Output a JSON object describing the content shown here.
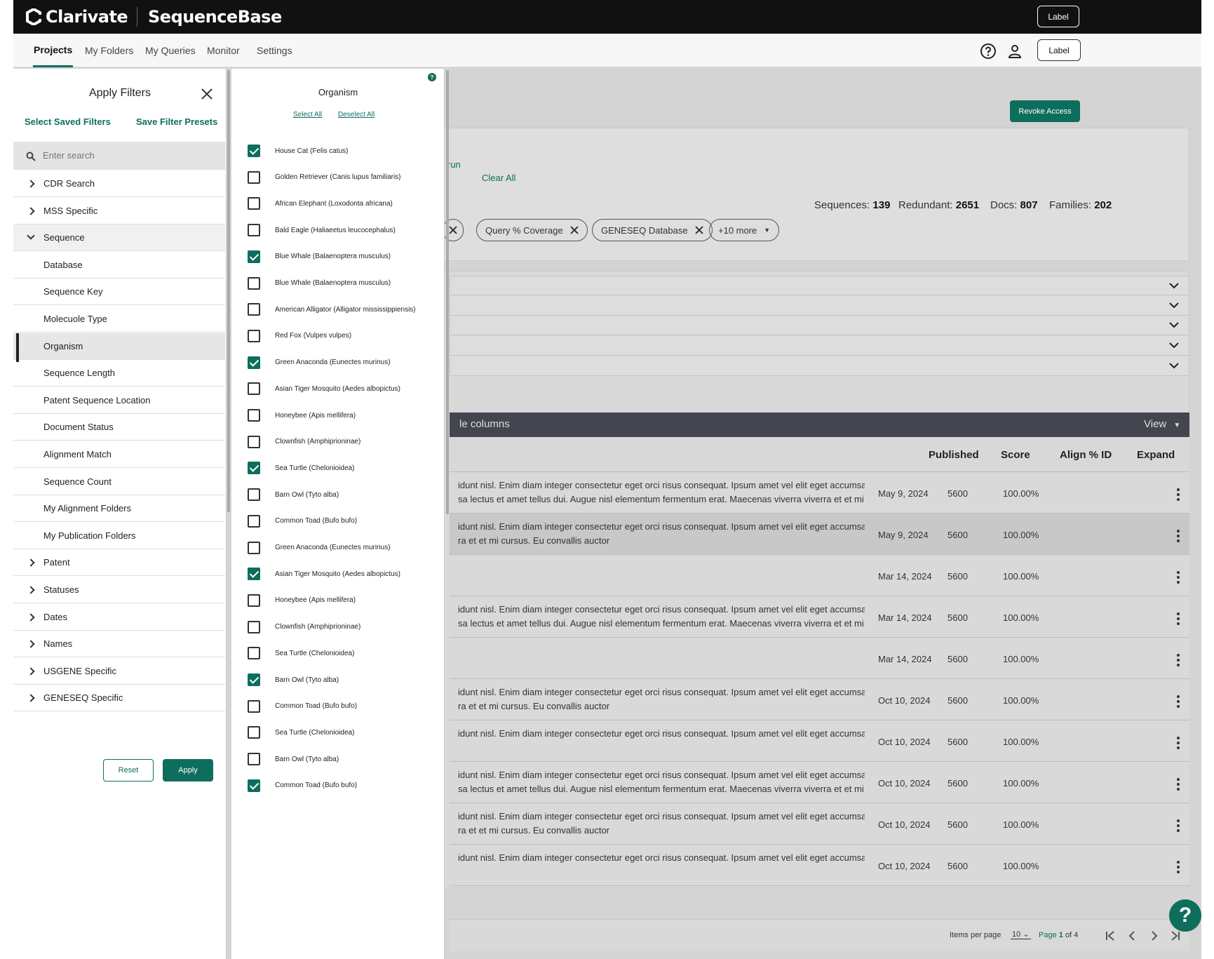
{
  "header": {
    "brand": "Clarivate",
    "product": "SequenceBase",
    "label_button": "Label"
  },
  "nav": {
    "tabs": [
      "Projects",
      "My Folders",
      "My Queries",
      "Monitor",
      "Settings"
    ],
    "active_tab": "Projects",
    "label_button": "Label",
    "icons": [
      "help-icon",
      "user-icon"
    ]
  },
  "main": {
    "revoke_button": "Revoke Access",
    "partial_link": "run",
    "clear_all": "Clear All",
    "stats": {
      "sequences_label": "Sequences:",
      "sequences": "139",
      "redundant_label": "Redundant:",
      "redundant": "2651",
      "docs_label": "Docs:",
      "docs": "807",
      "families_label": "Families:",
      "families": "202"
    },
    "chips": [
      "Query % Coverage",
      "GENESEQ Database"
    ],
    "more_chip": "+10 more",
    "table_bar_text": "le columns",
    "view_label": "View",
    "columns": [
      "Published",
      "Score",
      "Align % ID",
      "Expand"
    ],
    "rows": [
      {
        "line1": "idunt nisl. Enim diam integer consectetur eget orci risus consequat. Ipsum amet vel elit eget accumsan",
        "line2": "sa lectus et amet tellus dui. Augue nisl elementum fermentum erat. Maecenas viverra viverra et et mi",
        "published": "May 9, 2024",
        "score": "5600",
        "align": "100.00%"
      },
      {
        "line1": "idunt nisl. Enim diam integer consectetur eget orci risus consequat. Ipsum amet vel elit eget accumsan",
        "line2": "ra et et mi cursus. Eu convallis auctor",
        "published": "May 9, 2024",
        "score": "5600",
        "align": "100.00%"
      },
      {
        "line1": "",
        "line2": "",
        "published": "Mar 14, 2024",
        "score": "5600",
        "align": "100.00%"
      },
      {
        "line1": "idunt nisl. Enim diam integer consectetur eget orci risus consequat. Ipsum amet vel elit eget accumsan",
        "line2": "sa lectus et amet tellus dui. Augue nisl elementum fermentum erat. Maecenas viverra viverra et et mi",
        "published": "Mar 14, 2024",
        "score": "5600",
        "align": "100.00%"
      },
      {
        "line1": "",
        "line2": "",
        "published": "Mar 14, 2024",
        "score": "5600",
        "align": "100.00%"
      },
      {
        "line1": "idunt nisl. Enim diam integer consectetur eget orci risus consequat. Ipsum amet vel elit eget accumsan",
        "line2": "ra et et mi cursus. Eu convallis auctor",
        "published": "Oct 10, 2024",
        "score": "5600",
        "align": "100.00%"
      },
      {
        "line1": "idunt nisl. Enim diam integer consectetur eget orci risus consequat. Ipsum amet vel elit eget accumsan",
        "line2": "",
        "published": "Oct 10, 2024",
        "score": "5600",
        "align": "100.00%"
      },
      {
        "line1": "idunt nisl. Enim diam integer consectetur eget orci risus consequat. Ipsum amet vel elit eget accumsan",
        "line2": "sa lectus et amet tellus dui. Augue nisl elementum fermentum erat. Maecenas viverra viverra et et mi",
        "published": "Oct 10, 2024",
        "score": "5600",
        "align": "100.00%"
      },
      {
        "line1": "idunt nisl. Enim diam integer consectetur eget orci risus consequat. Ipsum amet vel elit eget accumsan",
        "line2": "ra et et mi cursus. Eu convallis auctor",
        "published": "Oct 10, 2024",
        "score": "5600",
        "align": "100.00%"
      },
      {
        "line1": "idunt nisl. Enim diam integer consectetur eget orci risus consequat. Ipsum amet vel elit eget accumsan",
        "line2": "",
        "published": "Oct 10, 2024",
        "score": "5600",
        "align": "100.00%"
      }
    ],
    "pager": {
      "items_per_page_label": "Items per page",
      "items_per_page": "10",
      "page_word": "Page",
      "current_page": "1",
      "of_text": "of 4"
    },
    "help_fab": "?"
  },
  "filters": {
    "title": "Apply Filters",
    "select_saved": "Select Saved Filters",
    "save_presets": "Save Filter Presets",
    "search_placeholder": "Enter search",
    "items": [
      {
        "label": "CDR Search",
        "kind": "group"
      },
      {
        "label": "MSS Specific",
        "kind": "group"
      },
      {
        "label": "Sequence",
        "kind": "open"
      },
      {
        "label": "Database",
        "kind": "child"
      },
      {
        "label": "Sequence Key",
        "kind": "child"
      },
      {
        "label": "Molecuole Type",
        "kind": "child"
      },
      {
        "label": "Organism",
        "kind": "selected"
      },
      {
        "label": "Sequence Length",
        "kind": "child"
      },
      {
        "label": "Patent Sequence Location",
        "kind": "child"
      },
      {
        "label": "Document Status",
        "kind": "child"
      },
      {
        "label": "Alignment Match",
        "kind": "child"
      },
      {
        "label": "Sequence Count",
        "kind": "child"
      },
      {
        "label": "My Alignment Folders",
        "kind": "child"
      },
      {
        "label": "My Publication Folders",
        "kind": "child"
      },
      {
        "label": "Patent",
        "kind": "group"
      },
      {
        "label": "Statuses",
        "kind": "group"
      },
      {
        "label": "Dates",
        "kind": "group"
      },
      {
        "label": "Names",
        "kind": "group"
      },
      {
        "label": "USGENE Specific",
        "kind": "group"
      },
      {
        "label": "GENESEQ Specific",
        "kind": "group"
      }
    ],
    "reset": "Reset",
    "apply": "Apply"
  },
  "organism": {
    "title": "Organism",
    "help": "?",
    "select_all": "Select All",
    "deselect_all": "Deselect All",
    "options": [
      {
        "label": "House Cat (Felis catus)",
        "checked": true
      },
      {
        "label": "Golden Retriever (Canis lupus familiaris)",
        "checked": false
      },
      {
        "label": "African Elephant (Loxodonta africana)",
        "checked": false
      },
      {
        "label": "Bald Eagle (Haliaeetus leucocephalus)",
        "checked": false
      },
      {
        "label": "Blue Whale (Balaenoptera musculus)",
        "checked": true
      },
      {
        "label": "Blue Whale (Balaenoptera musculus)",
        "checked": false
      },
      {
        "label": "American Alligator (Alligator mississippiensis)",
        "checked": false
      },
      {
        "label": "Red Fox (Vulpes vulpes)",
        "checked": false
      },
      {
        "label": "Green Anaconda (Eunectes murinus)",
        "checked": true
      },
      {
        "label": "Asian Tiger Mosquito (Aedes albopictus)",
        "checked": false
      },
      {
        "label": "Honeybee (Apis mellifera)",
        "checked": false
      },
      {
        "label": "Clownfish (Amphiprioninae)",
        "checked": false
      },
      {
        "label": "Sea Turtle (Chelonioidea)",
        "checked": true
      },
      {
        "label": "Barn Owl (Tyto alba)",
        "checked": false
      },
      {
        "label": "Common Toad (Bufo bufo)",
        "checked": false
      },
      {
        "label": "Green Anaconda (Eunectes murinus)",
        "checked": false
      },
      {
        "label": "Asian Tiger Mosquito (Aedes albopictus)",
        "checked": true
      },
      {
        "label": "Honeybee (Apis mellifera)",
        "checked": false
      },
      {
        "label": "Clownfish (Amphiprioninae)",
        "checked": false
      },
      {
        "label": "Sea Turtle (Chelonioidea)",
        "checked": false
      },
      {
        "label": "Barn Owl (Tyto alba)",
        "checked": true
      },
      {
        "label": "Common Toad (Bufo bufo)",
        "checked": false
      },
      {
        "label": "Sea Turtle (Chelonioidea)",
        "checked": false
      },
      {
        "label": "Barn Owl (Tyto alba)",
        "checked": false
      },
      {
        "label": "Common Toad (Bufo bufo)",
        "checked": true
      }
    ]
  },
  "colors": {
    "accent": "#0e6e5e",
    "topbar": "#111111",
    "table_bar": "#43464f"
  }
}
